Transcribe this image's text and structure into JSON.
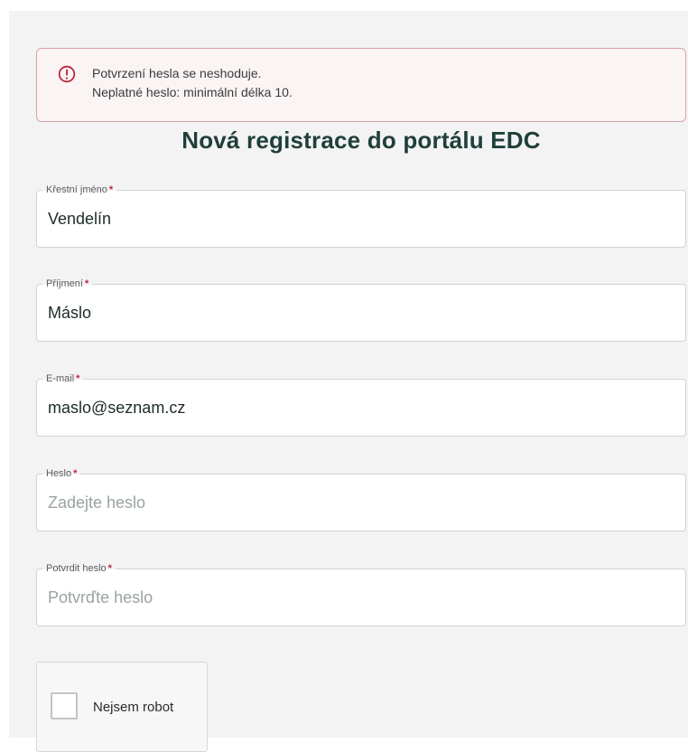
{
  "alert": {
    "messages": [
      "Potvrzení hesla se neshoduje.",
      "Neplatné heslo: minimální délka 10."
    ],
    "color": "#c0263b"
  },
  "form": {
    "title": "Nová registrace do portálu EDC",
    "required_marker": "*",
    "fields": [
      {
        "label": "Křestní jméno",
        "value": "Vendelín",
        "placeholder": ""
      },
      {
        "label": "Příjmení",
        "value": "Máslo",
        "placeholder": ""
      },
      {
        "label": "E-mail",
        "value": "maslo@seznam.cz",
        "placeholder": ""
      },
      {
        "label": "Heslo",
        "value": "",
        "placeholder": "Zadejte heslo"
      },
      {
        "label": "Potvrdit heslo",
        "value": "",
        "placeholder": "Potvrďte heslo"
      }
    ]
  },
  "captcha": {
    "label": "Nejsem robot",
    "checked": false
  },
  "colors": {
    "title": "#1f3f3a",
    "required": "#c0263b",
    "alert_border": "#d9a3a7"
  }
}
